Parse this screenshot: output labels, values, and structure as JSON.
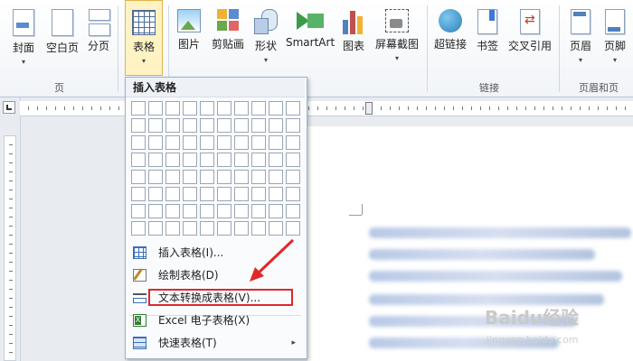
{
  "ribbon": {
    "buttons": [
      {
        "label": "封面",
        "has_arrow": true
      },
      {
        "label": "空白页",
        "has_arrow": false
      },
      {
        "label": "分页",
        "has_arrow": false
      },
      {
        "label": "表格",
        "has_arrow": true
      },
      {
        "label": "图片",
        "has_arrow": false
      },
      {
        "label": "剪贴画",
        "has_arrow": false
      },
      {
        "label": "形状",
        "has_arrow": true
      },
      {
        "label": "SmartArt",
        "has_arrow": false
      },
      {
        "label": "图表",
        "has_arrow": false
      },
      {
        "label": "屏幕截图",
        "has_arrow": true
      },
      {
        "label": "超链接",
        "has_arrow": false
      },
      {
        "label": "书签",
        "has_arrow": false
      },
      {
        "label": "交叉引用",
        "has_arrow": false
      },
      {
        "label": "页眉",
        "has_arrow": true
      },
      {
        "label": "页脚",
        "has_arrow": true
      }
    ],
    "groups": {
      "pages": "页",
      "links": "链接",
      "header_footer": "页眉和页"
    }
  },
  "insert_table_menu": {
    "title": "插入表格",
    "grid_rows": 8,
    "grid_cols": 10,
    "items": [
      {
        "label": "插入表格(I)...",
        "icon": "table-icon"
      },
      {
        "label": "绘制表格(D)",
        "icon": "draw-table-icon"
      },
      {
        "label": "文本转换成表格(V)...",
        "icon": "text-to-table-icon",
        "highlighted": true
      },
      {
        "label": "Excel 电子表格(X)",
        "icon": "excel-icon"
      },
      {
        "label": "快速表格(T)",
        "icon": "quick-table-icon",
        "submenu": "▸"
      }
    ]
  },
  "watermark": {
    "brand": "Baidu经验",
    "url": "jingyan.baidu.com"
  },
  "colors": {
    "accent": "#e0282a",
    "active_button": "#fff3c4",
    "ribbon_bg": "#f1f4f8"
  }
}
